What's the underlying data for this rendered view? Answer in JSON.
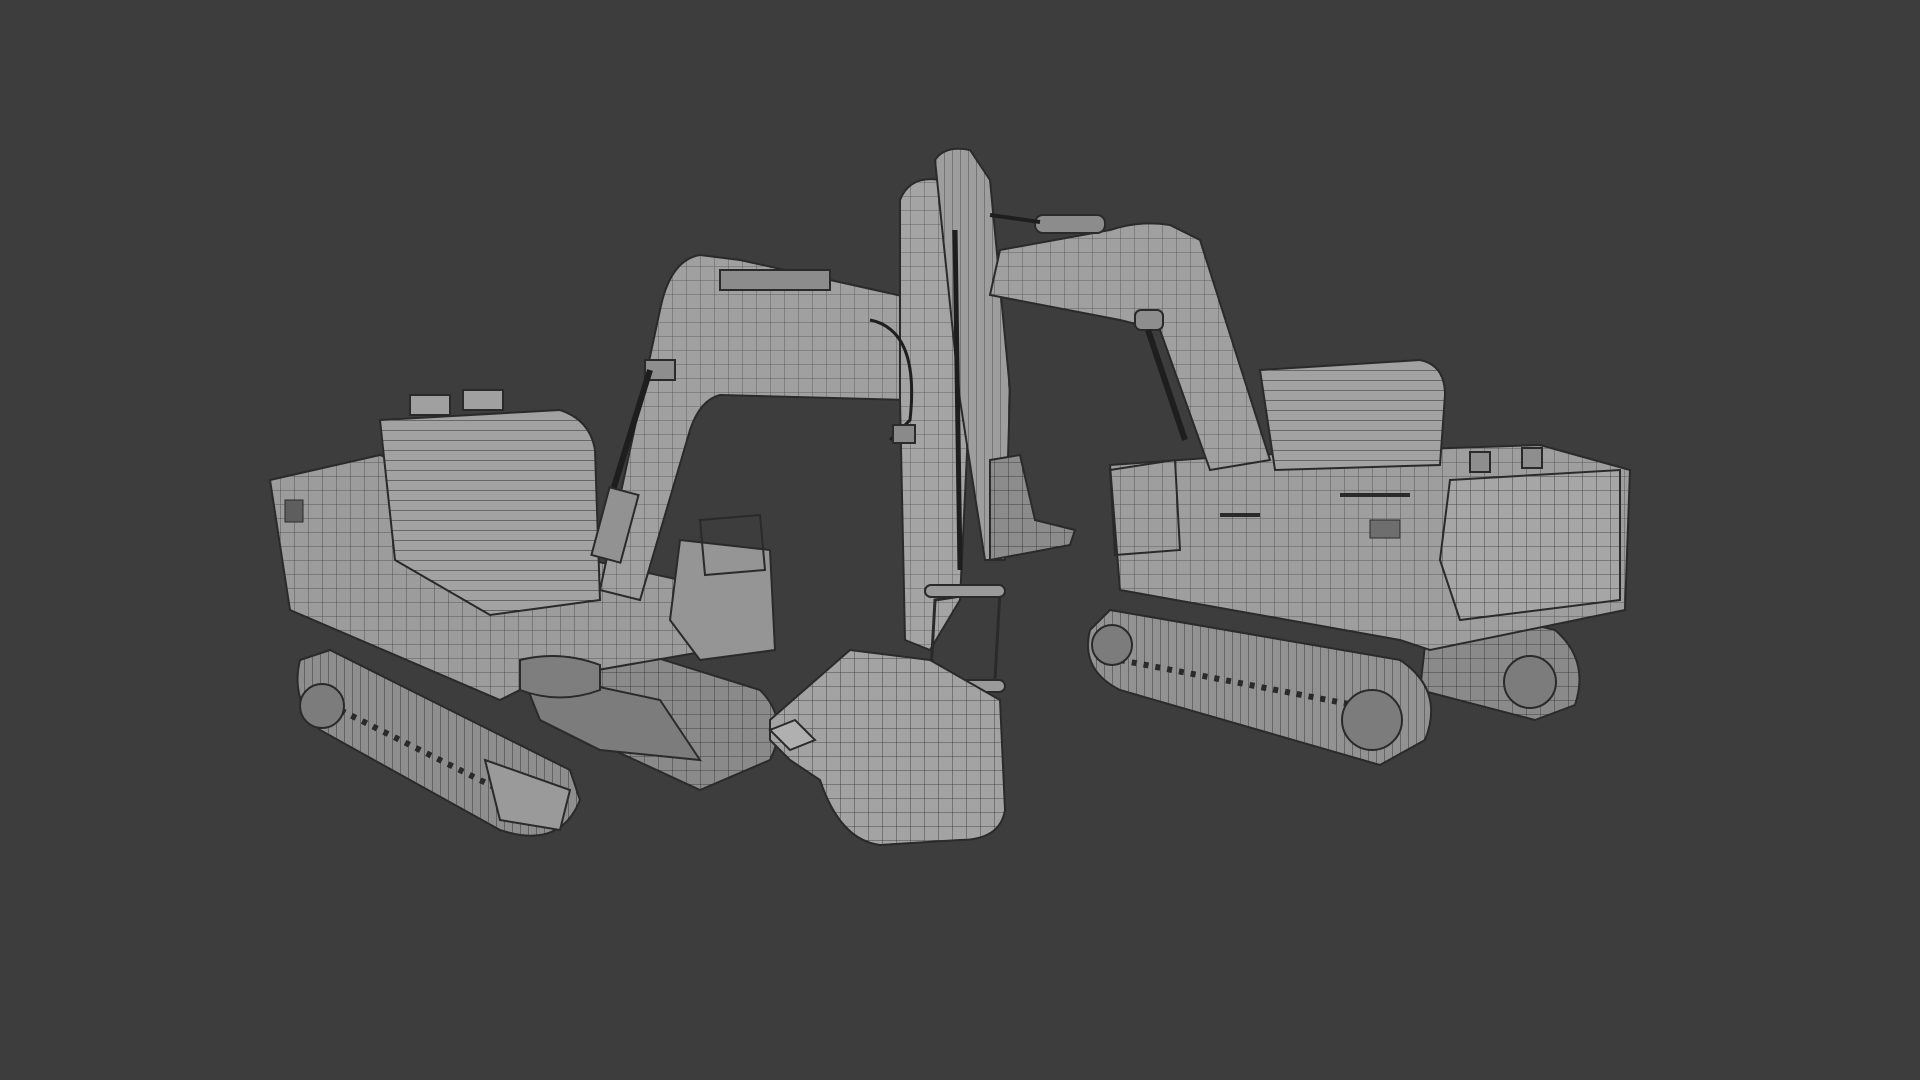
{
  "scene": {
    "background": "#3d3d3d",
    "model_fill": "#9a9a9a",
    "model_shade": "#7c7c7c",
    "model_dark": "#5e5e5e",
    "wire": "#2a2a2a",
    "highlight": "#b4b4b4",
    "objects": [
      "excavator-left",
      "excavator-right"
    ]
  }
}
